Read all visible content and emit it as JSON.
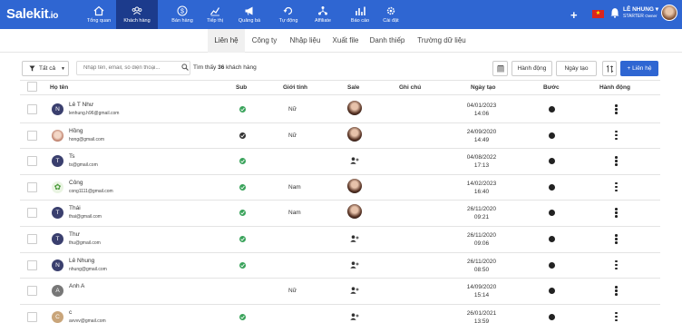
{
  "app": {
    "logo": "Salekit",
    "logo_suffix": ".io"
  },
  "nav": [
    {
      "label": "Tổng quan",
      "icon": "home-icon"
    },
    {
      "label": "Khách hàng",
      "icon": "users-icon",
      "active": true
    },
    {
      "label": "Bán hàng",
      "icon": "dollar-icon"
    },
    {
      "label": "Tiếp thị",
      "icon": "chart-icon"
    },
    {
      "label": "Quảng bá",
      "icon": "megaphone-icon"
    },
    {
      "label": "Tự động",
      "icon": "automation-icon"
    },
    {
      "label": "Affiliate",
      "icon": "network-icon"
    },
    {
      "label": "Báo cáo",
      "icon": "report-icon"
    },
    {
      "label": "Cài đặt",
      "icon": "gear-icon"
    }
  ],
  "user": {
    "name": "LÊ NHUNG",
    "plan": "STARTER",
    "role": "Owner",
    "plus": "+",
    "flag": "★"
  },
  "subtabs": [
    "Liên hệ",
    "Công ty",
    "Nhập liệu",
    "Xuất file",
    "Danh thiếp",
    "Trường dữ liệu"
  ],
  "toolbar": {
    "filter_label": "Tất cả",
    "search_placeholder": "Nhập tên, email, số điện thoại...",
    "found_prefix": "Tìm thấy",
    "found_count": "36",
    "found_suffix": "khách hàng",
    "action_label": "Hành động",
    "date_label": "Ngày tạo",
    "add_label": "+ Liên hệ"
  },
  "columns": [
    "Họ tên",
    "Sub",
    "Giới tính",
    "Sale",
    "Ghi chú",
    "Ngày tạo",
    "Bước",
    "Hành động"
  ],
  "rows": [
    {
      "avatar": "N",
      "avatar_type": "letter",
      "name": "Lê T Như",
      "email": "lenhung.h96@gmail.com",
      "sub": "green",
      "gender": "Nữ",
      "sale": "avatar",
      "date": "04/01/2023",
      "time": "14:06"
    },
    {
      "avatar": "",
      "avatar_type": "img",
      "name": "Hồng",
      "email": "hong@gmail.com",
      "sub": "dark",
      "gender": "Nữ",
      "sale": "avatar",
      "date": "24/09/2020",
      "time": "14:49"
    },
    {
      "avatar": "T",
      "avatar_type": "letter",
      "name": "Ts",
      "email": "ts@gmail.com",
      "sub": "green",
      "gender": "",
      "sale": "add",
      "date": "04/08/2022",
      "time": "17:13"
    },
    {
      "avatar": "✿",
      "avatar_type": "leaf",
      "name": "Công",
      "email": "cong1111@gmail.com",
      "sub": "green",
      "gender": "Nam",
      "sale": "avatar",
      "date": "14/02/2023",
      "time": "16:40"
    },
    {
      "avatar": "T",
      "avatar_type": "letter",
      "name": "Thái",
      "email": "thai@gmail.com",
      "sub": "green",
      "gender": "Nam",
      "sale": "avatar",
      "date": "26/11/2020",
      "time": "09:21"
    },
    {
      "avatar": "T",
      "avatar_type": "letter",
      "name": "Thư",
      "email": "thu@gmail.com",
      "sub": "green",
      "gender": "",
      "sale": "add",
      "date": "26/11/2020",
      "time": "09:06"
    },
    {
      "avatar": "N",
      "avatar_type": "letter",
      "name": "Lê Nhung",
      "email": "nhung@gmail.com",
      "sub": "green",
      "gender": "",
      "sale": "add",
      "date": "26/11/2020",
      "time": "08:50"
    },
    {
      "avatar": "A",
      "avatar_type": "gray",
      "name": "Anh A",
      "email": "",
      "sub": "",
      "gender": "Nữ",
      "sale": "add",
      "date": "14/09/2020",
      "time": "15:14"
    },
    {
      "avatar": "C",
      "avatar_type": "tan",
      "name": "c",
      "email": "avvvv@gmail.com",
      "sub": "green",
      "gender": "",
      "sale": "add",
      "date": "26/01/2021",
      "time": "13:59"
    }
  ],
  "colors": {
    "nav_bg": "#2f66d2",
    "nav_active": "#1c3b8c",
    "sub_green": "#3aa35b"
  }
}
